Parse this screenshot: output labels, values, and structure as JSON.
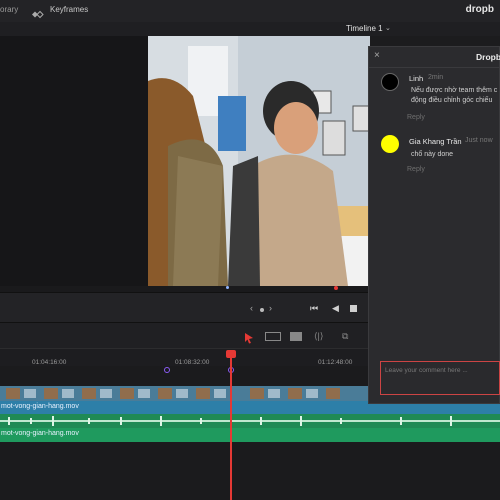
{
  "topbar": {
    "library_label": "orary",
    "keyframes_label": "Keyframes",
    "brand": "dropb"
  },
  "timeline_header": {
    "name": "Timeline 1",
    "chevron": "⌄"
  },
  "ruler": {
    "timecodes": [
      "01:04:16:00",
      "01:08:32:00",
      "01:12:48:00"
    ]
  },
  "tracks": {
    "video_clip_name": "mot-vong-gian-hang.mov",
    "audio_clip_name": "mot-vong-gian-hang.mov"
  },
  "comments_panel": {
    "title": "Dropbo",
    "close_symbol": "×",
    "comments": [
      {
        "author": "Linh",
        "time": "2min",
        "text_line1": "Nếu được nhờ team thêm c",
        "text_line2": "động điều chỉnh góc chiếu",
        "reply_label": "Reply",
        "avatar_color": "#000000"
      },
      {
        "author": "Gia Khang Trần",
        "time": "Just now",
        "text_line1": "chổ này done",
        "reply_label": "Reply",
        "avatar_color": "#ffff00"
      }
    ],
    "input_placeholder": "Leave your comment here ..."
  },
  "colors": {
    "playhead": "#e53935",
    "video_track": "#2d7fa8",
    "audio_track": "#1f9a5e",
    "marker": "#8b5cf6"
  }
}
